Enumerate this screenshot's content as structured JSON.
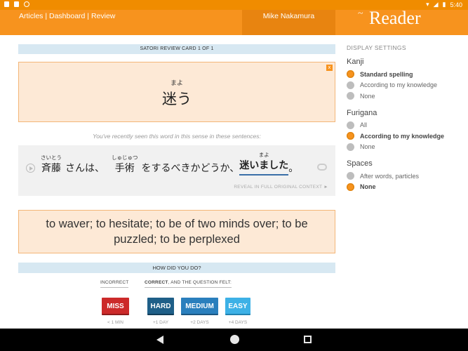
{
  "status": {
    "time": "5:40",
    "left_icons": [
      "a-icon",
      "sim-icon",
      "circle-icon"
    ]
  },
  "header": {
    "nav": [
      "Articles",
      "Dashboard",
      "Review"
    ],
    "separator": " | ",
    "user": "Mike Nakamura",
    "logo": "Reader"
  },
  "card": {
    "title": "SATORI REVIEW CARD 1 OF 1",
    "close": "x",
    "word_reading": "まよ",
    "word": "迷う",
    "recent_note": "You've recently seen this word in this sense in these sentences:",
    "sentence": [
      {
        "base": "斉藤",
        "ruby": "さいとう"
      },
      {
        "base": "さんは、",
        "ruby": ""
      },
      {
        "base": "手術",
        "ruby": "しゅじゅつ"
      },
      {
        "base": "をするべきかどうか、",
        "ruby": ""
      },
      {
        "base": "迷いました",
        "ruby": "まよ",
        "highlight": true
      },
      {
        "base": "。",
        "ruby": ""
      }
    ],
    "reveal": "REVEAL IN FULL ORIGINAL CONTEXT ►",
    "definition": "to waver; to hesitate; to be of two minds over; to be puzzled; to be perplexed"
  },
  "grading": {
    "title": "HOW DID YOU DO?",
    "incorrect_label": "INCORRECT",
    "correct_label_bold": "CORRECT",
    "correct_label_rest": ", AND THE QUESTION FELT:",
    "buttons": [
      {
        "label": "MISS",
        "time": "< 1 MIN"
      },
      {
        "label": "HARD",
        "time": "+1 DAY"
      },
      {
        "label": "MEDIUM",
        "time": "+2 DAYS"
      },
      {
        "label": "EASY",
        "time": "+4 DAYS"
      }
    ]
  },
  "settings": {
    "title": "DISPLAY SETTINGS",
    "groups": [
      {
        "name": "Kanji",
        "options": [
          "Standard spelling",
          "According to my knowledge",
          "None"
        ],
        "selected": 0
      },
      {
        "name": "Furigana",
        "options": [
          "All",
          "According to my knowledge",
          "None"
        ],
        "selected": 1
      },
      {
        "name": "Spaces",
        "options": [
          "After words, particles",
          "None"
        ],
        "selected": 1
      }
    ]
  },
  "colors": {
    "accent": "#f7931e",
    "card_bg": "#fde9d6",
    "header_bar": "#d7e8f2",
    "miss": "#cc2a2a",
    "hard": "#1f5f88",
    "medium": "#2a7fbd",
    "easy": "#3db1e6"
  }
}
